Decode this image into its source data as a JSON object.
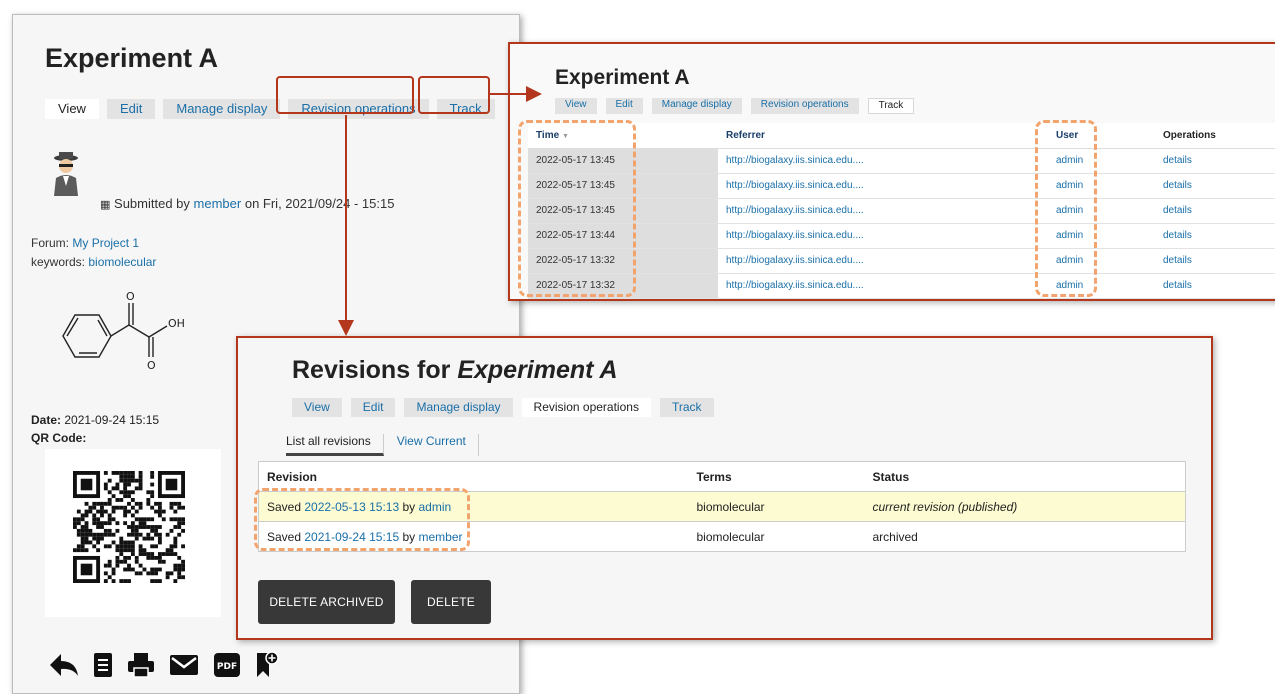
{
  "node": {
    "title": "Experiment A",
    "tabs": [
      {
        "label": "View",
        "active": true
      },
      {
        "label": "Edit",
        "active": false
      },
      {
        "label": "Manage display",
        "active": false
      },
      {
        "label": "Revision operations",
        "active": false
      },
      {
        "label": "Track",
        "active": false
      }
    ],
    "submitted_prefix": "Submitted by",
    "submitted_user": "member",
    "submitted_suffix": "on Fri, 2021/09/24 - 15:15",
    "forum_label": "Forum:",
    "forum_value": "My Project 1",
    "keywords_label": "keywords:",
    "keywords_value": "biomolecular",
    "date_label": "Date:",
    "date_value": "2021-09-24 15:15",
    "qr_label": "QR Code:",
    "icons": [
      "back-arrow-icon",
      "document-icon",
      "print-icon",
      "mail-icon",
      "pdf-icon",
      "bookmark-add-icon"
    ],
    "pdf_text": "PDF"
  },
  "track": {
    "title": "Experiment A",
    "tabs": [
      {
        "label": "View",
        "active": false
      },
      {
        "label": "Edit",
        "active": false
      },
      {
        "label": "Manage display",
        "active": false
      },
      {
        "label": "Revision operations",
        "active": false
      },
      {
        "label": "Track",
        "active": true
      }
    ],
    "columns": [
      "Time",
      "Referrer",
      "User",
      "Operations"
    ],
    "sort_indicator": "▼",
    "rows": [
      {
        "time": "2022-05-17 13:45",
        "referrer": "http://biogalaxy.iis.sinica.edu....",
        "user": "admin",
        "op": "details"
      },
      {
        "time": "2022-05-17 13:45",
        "referrer": "http://biogalaxy.iis.sinica.edu....",
        "user": "admin",
        "op": "details"
      },
      {
        "time": "2022-05-17 13:45",
        "referrer": "http://biogalaxy.iis.sinica.edu....",
        "user": "admin",
        "op": "details"
      },
      {
        "time": "2022-05-17 13:44",
        "referrer": "http://biogalaxy.iis.sinica.edu....",
        "user": "admin",
        "op": "details"
      },
      {
        "time": "2022-05-17 13:32",
        "referrer": "http://biogalaxy.iis.sinica.edu....",
        "user": "admin",
        "op": "details"
      },
      {
        "time": "2022-05-17 13:32",
        "referrer": "http://biogalaxy.iis.sinica.edu....",
        "user": "admin",
        "op": "details"
      }
    ]
  },
  "revisions": {
    "title_prefix": "Revisions for ",
    "title_node": "Experiment A",
    "tabs": [
      {
        "label": "View",
        "active": false
      },
      {
        "label": "Edit",
        "active": false
      },
      {
        "label": "Manage display",
        "active": false
      },
      {
        "label": "Revision operations",
        "active": true
      },
      {
        "label": "Track",
        "active": false
      }
    ],
    "subtabs": [
      {
        "label": "List all revisions",
        "active": true
      },
      {
        "label": "View Current",
        "active": false
      }
    ],
    "columns": [
      "Revision",
      "Terms",
      "Status"
    ],
    "rows": [
      {
        "prefix": "Saved",
        "date": "2022-05-13 15:13",
        "by": "by",
        "user": "admin",
        "terms": "biomolecular",
        "status": "current revision (published)",
        "current": true
      },
      {
        "prefix": "Saved",
        "date": "2021-09-24 15:15",
        "by": "by",
        "user": "member",
        "terms": "biomolecular",
        "status": "archived",
        "current": false
      }
    ],
    "delete_archived_label": "DELETE ARCHIVED",
    "delete_label": "DELETE"
  },
  "colors": {
    "highlight_red": "#b2371c",
    "highlight_orange": "#f2a46e",
    "link": "#1a6fa8",
    "current_row": "#fdfbd2"
  }
}
